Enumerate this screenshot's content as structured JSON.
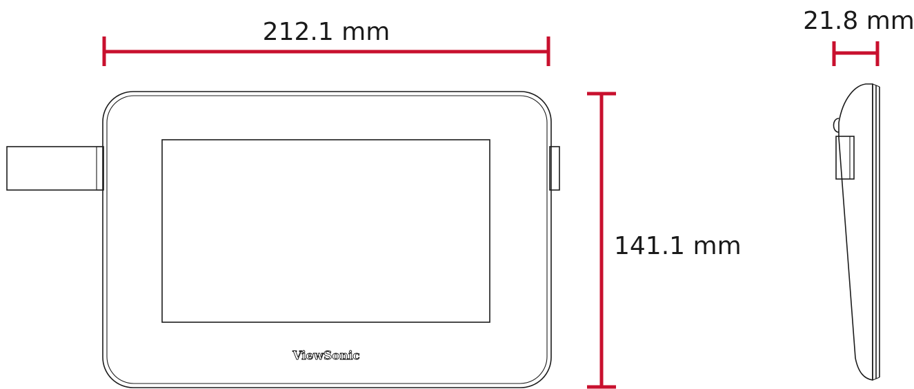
{
  "dimensions": {
    "width_label": "212.1 mm",
    "height_label": "141.1 mm",
    "depth_label": "21.8 mm"
  },
  "device": {
    "brand": "ViewSonic"
  },
  "colors": {
    "dimension_line": "#c8102e",
    "outline": "#1a1a1a",
    "background": "#ffffff"
  }
}
